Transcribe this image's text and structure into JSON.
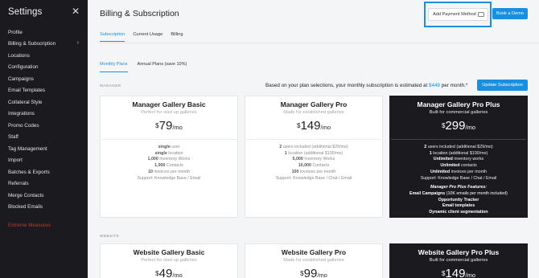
{
  "sidebar": {
    "title": "Settings",
    "close_icon": "✕",
    "items": [
      {
        "label": "Profile"
      },
      {
        "label": "Billing & Subscription",
        "has_chevron": true
      },
      {
        "label": "Locations"
      },
      {
        "label": "Configuration"
      },
      {
        "label": "Campaigns"
      },
      {
        "label": "Email Templates"
      },
      {
        "label": "Collateral Style"
      },
      {
        "label": "Integrations"
      },
      {
        "label": "Promo Codes"
      },
      {
        "label": "Staff"
      },
      {
        "label": "Tag Management"
      },
      {
        "label": "Import"
      },
      {
        "label": "Batches & Exports"
      },
      {
        "label": "Referrals"
      },
      {
        "label": "Merge Contacts"
      },
      {
        "label": "Blocked Emails"
      }
    ],
    "danger_item": "Extreme Measures",
    "chevron_icon": "›"
  },
  "header": {
    "title": "Billing & Subscription",
    "add_payment_label": "Add Payment Method",
    "book_demo_label": "Book a Demo"
  },
  "tabs": [
    "Subscription",
    "Current Usage",
    "Billing"
  ],
  "subtabs": [
    "Monthly Plans",
    "Annual Plans (save 10%)"
  ],
  "sections": {
    "manager": "MANAGER",
    "website": "WEBSITE"
  },
  "estimate": {
    "prefix": "Based on your plan selections, your monthly subscription is estimated at ",
    "amount": "$448",
    "suffix": " per month.*"
  },
  "update_label": "Update Subscription",
  "manager_plans": [
    {
      "title": "Manager Gallery Basic",
      "subtitle": "Perfect for start up galleries",
      "currency": "$",
      "price": "79",
      "period": "/mo",
      "features": [
        {
          "bold": "single",
          "text": " user"
        },
        {
          "bold": "single",
          "text": " location"
        },
        {
          "bold": "1,000",
          "text": " Inventory Works"
        },
        {
          "bold": "1,000",
          "text": " Contacts"
        },
        {
          "bold": "10",
          "text": " invoices per month"
        },
        {
          "bold": "",
          "text": "Support: Knowledge Base / Email"
        }
      ]
    },
    {
      "title": "Manager Gallery Pro",
      "subtitle": "Made for established galleries",
      "currency": "$",
      "price": "149",
      "period": "/mo",
      "features": [
        {
          "bold": "2",
          "text": " users included (additional $29/mo)"
        },
        {
          "bold": "1",
          "text": " location (additional $100/mo)"
        },
        {
          "bold": "5,000",
          "text": " Inventory Works"
        },
        {
          "bold": "10,000",
          "text": " Contacts"
        },
        {
          "bold": "100",
          "text": " invoices per month"
        },
        {
          "bold": "",
          "text": "Support: Knowledge Base / Chat / Email"
        }
      ]
    },
    {
      "title": "Manager Gallery Pro Plus",
      "subtitle": "Built for commercial galleries",
      "currency": "$",
      "price": "299",
      "period": "/mo",
      "features": [
        {
          "bold": "2",
          "text": " users included (additional $29/mo)"
        },
        {
          "bold": "1",
          "text": " location (additional $100/mo)"
        },
        {
          "bold": "Unlimited",
          "text": " inventory works"
        },
        {
          "bold": "Unlimited",
          "text": " contacts"
        },
        {
          "bold": "Unlimited",
          "text": " invoices per month"
        },
        {
          "bold": "",
          "text": "Support: Knowledge Base / Chat / Email"
        }
      ],
      "plus_title": "Manager Pro Plus Features:",
      "plus_features": [
        {
          "text": "Email Campaigns",
          "muted": " (10K emails per month included)"
        },
        {
          "text": "Opportunity Tracker",
          "muted": ""
        },
        {
          "text": "Email templates",
          "muted": ""
        },
        {
          "text": "Dynamic client segmentation",
          "muted": ""
        }
      ]
    }
  ],
  "website_plans": [
    {
      "title": "Website Gallery Basic",
      "subtitle": "Perfect for start up galleries",
      "currency": "$",
      "price": "49",
      "period": "/mo"
    },
    {
      "title": "Website Gallery Pro",
      "subtitle": "Made for established galleries",
      "currency": "$",
      "price": "99",
      "period": "/mo"
    },
    {
      "title": "Website Gallery Pro Plus",
      "subtitle": "Built for commercial galleries",
      "currency": "$",
      "price": "149",
      "period": "/mo"
    }
  ],
  "colors": {
    "accent": "#1a8fe0",
    "sidebar_bg": "#1b1b1f",
    "danger": "#c0392b",
    "highlight_outline": "#1f8fd8"
  }
}
